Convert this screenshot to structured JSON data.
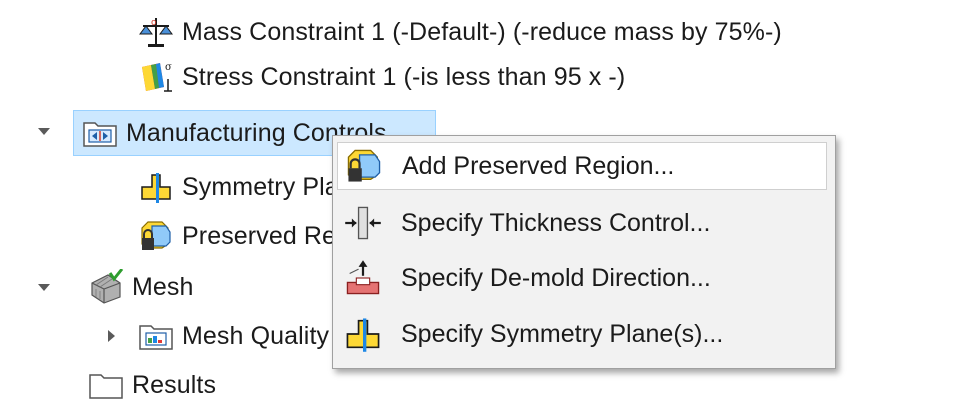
{
  "tree": {
    "items": [
      {
        "label": "Mass Constraint 1 (-Default-)  (-reduce mass by 75%-)",
        "icon": "mass-constraint-icon"
      },
      {
        "label": "Stress Constraint 1 (-is less than 95 x -)",
        "icon": "stress-constraint-icon"
      },
      {
        "label": "Manufacturing Controls",
        "icon": "manufacturing-controls-folder-icon",
        "expanded": true,
        "selected": true
      },
      {
        "label": "Symmetry Plane",
        "icon": "symmetry-plane-icon"
      },
      {
        "label": "Preserved Region",
        "icon": "preserved-region-icon"
      },
      {
        "label": "Mesh",
        "icon": "mesh-icon",
        "expanded": true
      },
      {
        "label": "Mesh Quality",
        "icon": "mesh-quality-folder-icon",
        "expanded": false
      },
      {
        "label": "Results",
        "icon": "results-folder-icon"
      }
    ]
  },
  "context_menu": {
    "items": [
      {
        "label": "Add Preserved Region...",
        "icon": "preserved-region-icon",
        "hover": true
      },
      {
        "label": "Specify Thickness Control...",
        "icon": "thickness-control-icon"
      },
      {
        "label": "Specify De-mold Direction...",
        "icon": "demold-direction-icon"
      },
      {
        "label": "Specify Symmetry Plane(s)...",
        "icon": "symmetry-plane-icon"
      }
    ]
  },
  "colors": {
    "selection_bg": "#cce8ff",
    "selection_border": "#99d1ff",
    "menu_bg": "#f2f2f2",
    "menu_hover_bg": "#ffffff"
  }
}
